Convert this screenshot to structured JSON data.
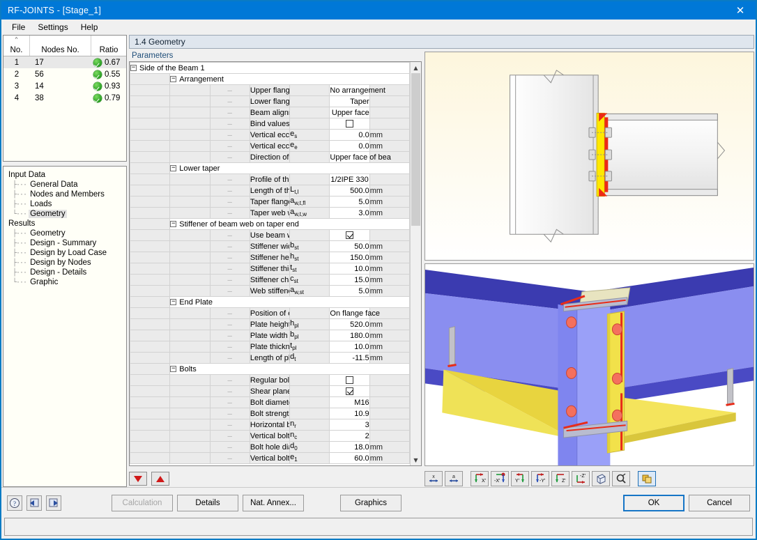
{
  "window": {
    "title": "RF-JOINTS - [Stage_1]",
    "close_icon": "close-icon"
  },
  "menubar": {
    "items": [
      "File",
      "Settings",
      "Help"
    ]
  },
  "node_table": {
    "columns": [
      "No.",
      "Nodes No.",
      "Ratio"
    ],
    "rows": [
      {
        "no": "1",
        "nodes": "17",
        "ratio": "0.67",
        "status": "ok"
      },
      {
        "no": "2",
        "nodes": "56",
        "ratio": "0.55",
        "status": "ok"
      },
      {
        "no": "3",
        "nodes": "14",
        "ratio": "0.93",
        "status": "ok"
      },
      {
        "no": "4",
        "nodes": "38",
        "ratio": "0.79",
        "status": "ok"
      }
    ]
  },
  "tree": {
    "groups": [
      {
        "label": "Input Data",
        "items": [
          "General Data",
          "Nodes and Members",
          "Loads",
          "Geometry"
        ]
      },
      {
        "label": "Results",
        "items": [
          "Geometry",
          "Design - Summary",
          "Design by Load Case",
          "Design by Nodes",
          "Design - Details",
          "Graphic"
        ]
      }
    ],
    "selected": "Geometry"
  },
  "section": {
    "header": "1.4 Geometry",
    "parameters_label": "Parameters"
  },
  "params": {
    "rows": [
      {
        "kind": "group1",
        "label": "Side of the Beam 1",
        "expander": "−"
      },
      {
        "kind": "group2",
        "label": "Arrangement",
        "expander": "−"
      },
      {
        "kind": "item",
        "label": "Upper flange arrangement",
        "sym": "",
        "sub": "",
        "value": "No arrangement",
        "unit": "",
        "align": "center"
      },
      {
        "kind": "item",
        "label": "Lower flange arrangement",
        "sym": "",
        "sub": "",
        "value": "Taper",
        "unit": "",
        "align": "right"
      },
      {
        "kind": "item",
        "label": "Beam alignment setting (for eccentric",
        "sym": "",
        "sub": "",
        "value": "Upper face",
        "unit": "",
        "align": "right"
      },
      {
        "kind": "check",
        "label": "Bind values of eccentricity together",
        "sym": "",
        "sub": "",
        "checked": false,
        "unit": ""
      },
      {
        "kind": "item",
        "label": "Vertical eccentricity at member start",
        "sym": "e",
        "sub": "s",
        "value": "0.0",
        "unit": "mm",
        "align": "right"
      },
      {
        "kind": "item",
        "label": "Vertical eccentricity at member end",
        "sym": "e",
        "sub": "e",
        "value": "0.0",
        "unit": "mm",
        "align": "right"
      },
      {
        "kind": "item",
        "label": "Direction of projection on column fac",
        "sym": "",
        "sub": "",
        "value": "Upper face of bea",
        "unit": "",
        "align": "center"
      },
      {
        "kind": "group2",
        "label": "Lower taper",
        "expander": "−"
      },
      {
        "kind": "item",
        "label": "Profile of the taper",
        "sym": "",
        "sub": "",
        "value": "1/2IPE 330",
        "unit": "",
        "align": "center"
      },
      {
        "kind": "item",
        "label": "Length of the lower tapered part",
        "sym": "L",
        "sub": "t,l",
        "value": "500.0",
        "unit": "mm",
        "align": "right"
      },
      {
        "kind": "item",
        "label": "Taper flange weld dimension",
        "sym": "a",
        "sub": "w,t,fl",
        "value": "5.0",
        "unit": "mm",
        "align": "right"
      },
      {
        "kind": "item",
        "label": "Taper web weld dimension",
        "sym": "a",
        "sub": "w,t,w",
        "value": "3.0",
        "unit": "mm",
        "align": "right"
      },
      {
        "kind": "group2",
        "label": "Stiffener of beam web on taper end",
        "expander": "−"
      },
      {
        "kind": "check",
        "label": "Use beam web stiffener on taper end",
        "sym": "",
        "sub": "",
        "checked": true,
        "unit": ""
      },
      {
        "kind": "item",
        "label": "Stiffener width",
        "sym": "b",
        "sub": "st",
        "value": "50.0",
        "unit": "mm",
        "align": "right"
      },
      {
        "kind": "item",
        "label": "Stiffener height",
        "sym": "h",
        "sub": "st",
        "value": "150.0",
        "unit": "mm",
        "align": "right"
      },
      {
        "kind": "item",
        "label": "Stiffener thickness",
        "sym": "t",
        "sub": "st",
        "value": "10.0",
        "unit": "mm",
        "align": "right"
      },
      {
        "kind": "item",
        "label": "Stiffener chamfer dimension",
        "sym": "c",
        "sub": "st",
        "value": "15.0",
        "unit": "mm",
        "align": "right"
      },
      {
        "kind": "item",
        "label": "Web stiffener weld dimension",
        "sym": "a",
        "sub": "w,st",
        "value": "5.0",
        "unit": "mm",
        "align": "right"
      },
      {
        "kind": "group2",
        "label": "End Plate",
        "expander": "−"
      },
      {
        "kind": "item",
        "label": "Position of end plate weld",
        "sym": "",
        "sub": "",
        "value": "On flange face",
        "unit": "",
        "align": "center"
      },
      {
        "kind": "item",
        "label": "Plate height",
        "sym": "h",
        "sub": "pl",
        "value": "520.0",
        "unit": "mm",
        "align": "right"
      },
      {
        "kind": "item",
        "label": "Plate width",
        "sym": "b",
        "sub": "pl",
        "value": "180.0",
        "unit": "mm",
        "align": "right"
      },
      {
        "kind": "item",
        "label": "Plate thickness",
        "sym": "t",
        "sub": "pl",
        "value": "10.0",
        "unit": "mm",
        "align": "right"
      },
      {
        "kind": "item",
        "label": "Length of plate overhang",
        "sym": "d",
        "sub": "t",
        "value": "-11.5",
        "unit": "mm",
        "align": "right"
      },
      {
        "kind": "group2",
        "label": "Bolts",
        "expander": "−"
      },
      {
        "kind": "check",
        "label": "Regular bolt distribution",
        "sym": "",
        "sub": "",
        "checked": false,
        "unit": ""
      },
      {
        "kind": "check",
        "label": "Shear plane passes through the thre",
        "sym": "",
        "sub": "",
        "checked": true,
        "unit": ""
      },
      {
        "kind": "item",
        "label": "Bolt diameter",
        "sym": "",
        "sub": "",
        "value": "M16",
        "unit": "",
        "align": "right"
      },
      {
        "kind": "item",
        "label": "Bolt strength grade",
        "sym": "",
        "sub": "",
        "value": "10.9",
        "unit": "",
        "align": "right"
      },
      {
        "kind": "item",
        "label": "Horizontal bolt rows",
        "sym": "n",
        "sub": "r",
        "value": "3",
        "unit": "",
        "align": "right"
      },
      {
        "kind": "item",
        "label": "Vertical bolt rows",
        "sym": "n",
        "sub": "c",
        "value": "2",
        "unit": "",
        "align": "right"
      },
      {
        "kind": "item",
        "label": "Bolt hole diameter",
        "sym": "d",
        "sub": "0",
        "value": "18.0",
        "unit": "mm",
        "align": "right"
      },
      {
        "kind": "item",
        "label": "Vertical bolt to edge distance",
        "sym": "e",
        "sub": "1",
        "value": "60.0",
        "unit": "mm",
        "align": "right"
      }
    ],
    "nav_down_icon": "triangle-down-icon",
    "nav_up_icon": "triangle-up-icon"
  },
  "view_toolbar": {
    "buttons": [
      {
        "name": "show-dimension-x-button",
        "label": "x"
      },
      {
        "name": "show-label-a-button",
        "label": "a"
      },
      {
        "name": "view-x-button",
        "label": "X'"
      },
      {
        "name": "view-negative-x-button",
        "label": "-X'"
      },
      {
        "name": "view-y-button",
        "label": "Y'"
      },
      {
        "name": "view-negative-y-button",
        "label": "-Y'"
      },
      {
        "name": "view-z-button",
        "label": "Z'"
      },
      {
        "name": "view-negative-z-button",
        "label": "-Z'"
      },
      {
        "name": "isometric-view-button",
        "label": ""
      },
      {
        "name": "zoom-view-button",
        "label": ""
      },
      {
        "name": "render-mode-button",
        "label": ""
      }
    ]
  },
  "footer": {
    "help_icon": "help-icon",
    "prev_icon": "previous-arrow-icon",
    "next_icon": "next-arrow-icon",
    "calculation": "Calculation",
    "details": "Details",
    "national_annex": "Nat. Annex...",
    "graphics": "Graphics",
    "ok": "OK",
    "cancel": "Cancel"
  },
  "colors": {
    "title_bar": "#0078d7",
    "window_border": "#0a7bc4",
    "section_header": "#dfe6ee",
    "steel_blue": "#8a8ef0",
    "plate_yellow": "#f2e14a",
    "weld_red": "#e82c19",
    "status_ok_green": "#249a1e"
  }
}
